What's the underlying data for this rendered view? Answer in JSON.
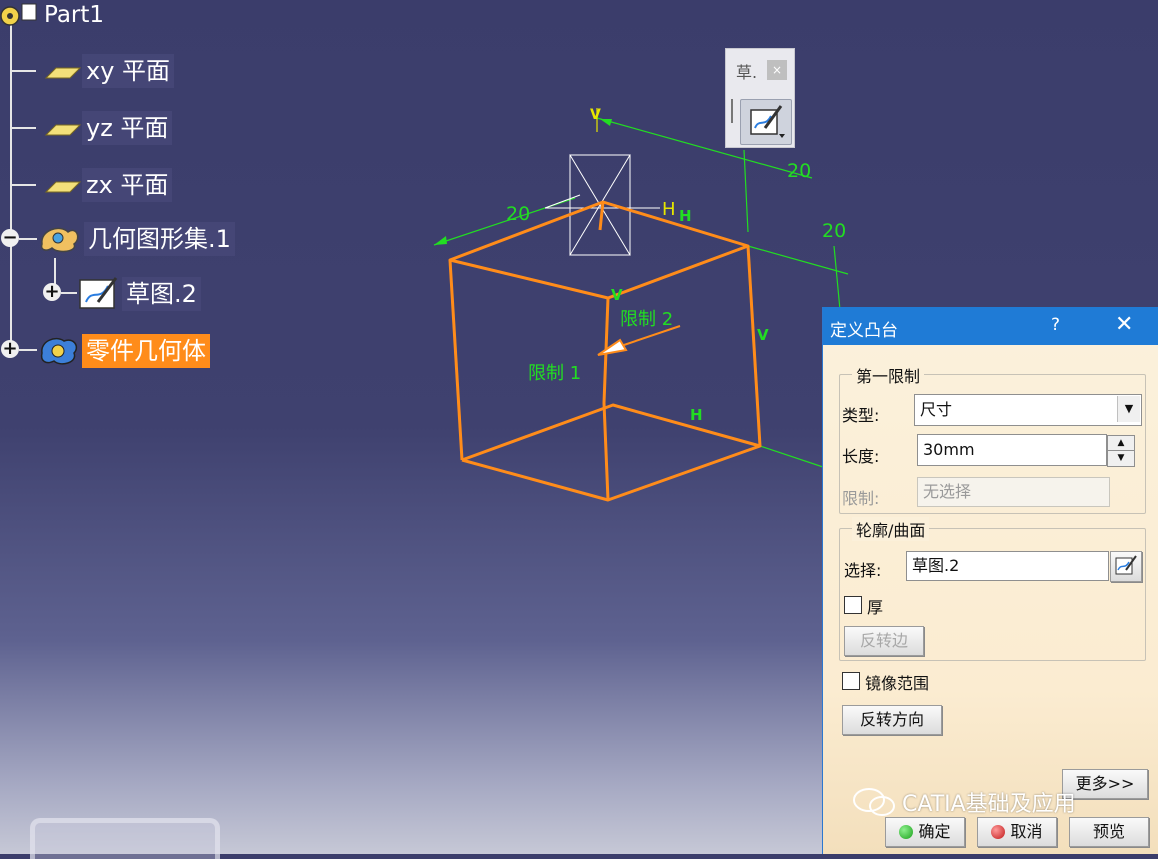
{
  "tree": {
    "root": "Part1",
    "plane_xy": "xy 平面",
    "plane_yz": "yz 平面",
    "plane_zx": "zx 平面",
    "geoset": "几何图形集.1",
    "sketch": "草图.2",
    "body": "零件几何体"
  },
  "toolbar": {
    "title": "草.",
    "close": "×"
  },
  "viewport": {
    "dim1": "20",
    "dim2": "20",
    "dim3": "20",
    "h_upper": "H",
    "h_upper2": "H",
    "v_top": "V",
    "v_mid": "V",
    "v_right": "V",
    "h_bottom": "H",
    "limit1": "限制 1",
    "limit2": "限制 2",
    "accent_orange": "#ff8c1a",
    "accent_green": "#22dd22"
  },
  "dialog": {
    "title": "定义凸台",
    "help": "?",
    "close": "✕",
    "first_limit": {
      "group": "第一限制",
      "type_label": "类型:",
      "type_value": "尺寸",
      "length_label": "长度:",
      "length_value": "30mm",
      "limit_label": "限制:",
      "limit_value": "无选择"
    },
    "profile": {
      "group": "轮廓/曲面",
      "select_label": "选择:",
      "select_value": "草图.2",
      "thick_label": "厚",
      "reverse_side": "反转边"
    },
    "mirror_label": "镜像范围",
    "reverse_dir": "反转方向",
    "more": "更多>>",
    "ok": "确定",
    "cancel": "取消",
    "preview": "预览"
  },
  "watermark": "CATIA基础及应用"
}
